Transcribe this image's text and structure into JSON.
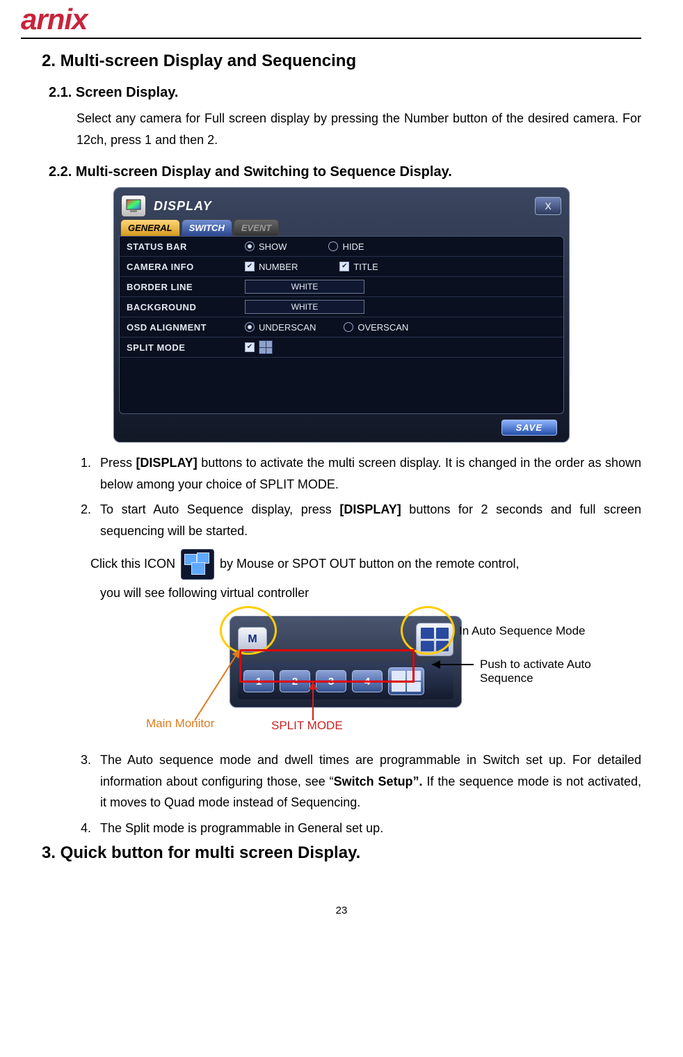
{
  "logo": "arnix",
  "section2_title": "2. Multi-screen Display and Sequencing",
  "sec21_title": "2.1.  Screen  Display.",
  "sec21_body": "Select any camera for Full screen display by pressing the Number button of the desired camera.    For 12ch, press 1 and then 2.",
  "sec22_title": "2.2.  Multi-screen  Display  and  Switching  to  Sequence  Display.",
  "dvr": {
    "title": "DISPLAY",
    "close": "X",
    "tabs": {
      "general": "GENERAL",
      "switch": "SWITCH",
      "event": "EVENT"
    },
    "rows": {
      "status_bar": "STATUS BAR",
      "camera_info": "CAMERA INFO",
      "border_line": "BORDER LINE",
      "background": "BACKGROUND",
      "osd_alignment": "OSD ALIGNMENT",
      "split_mode": "SPLIT MODE"
    },
    "opts": {
      "show": "SHOW",
      "hide": "HIDE",
      "number": "NUMBER",
      "title_opt": "TITLE",
      "white1": "WHITE",
      "white2": "WHITE",
      "underscan": "UNDERSCAN",
      "overscan": "OVERSCAN"
    },
    "save": "SAVE"
  },
  "step1_a": "Press ",
  "step1_b": "[DISPLAY]",
  "step1_c": " buttons to activate the multi screen display. It is changed in the order as shown below among your choice of SPLIT MODE.",
  "step2_a": "To start Auto Sequence display, press ",
  "step2_b": "[DISPLAY]",
  "step2_c": " buttons for 2 seconds and full screen sequencing will be started.",
  "icon_pre": "Click this ICON",
  "icon_post": "by Mouse or SPOT OUT button on the remote control,",
  "icon_line2": "you will see following virtual controller",
  "vc": {
    "m": "M",
    "n1": "1",
    "n2": "2",
    "n3": "3",
    "n4": "4"
  },
  "call_main": "Main Monitor",
  "call_split": "SPLIT MODE",
  "call_auto": "In Auto Sequence Mode",
  "call_push": "Push to activate Auto Sequence",
  "step3_a": "The Auto sequence mode and dwell times are programmable in Switch set up. For detailed information about configuring those, see “",
  "step3_b": "Switch Setup”.",
  "step3_c": "  If the sequence mode is not activated, it moves to Quad mode instead of Sequencing.",
  "step4": "The Split mode is programmable in General set up.",
  "section3_title": "3. Quick button for multi screen Display.",
  "page_number": "23"
}
